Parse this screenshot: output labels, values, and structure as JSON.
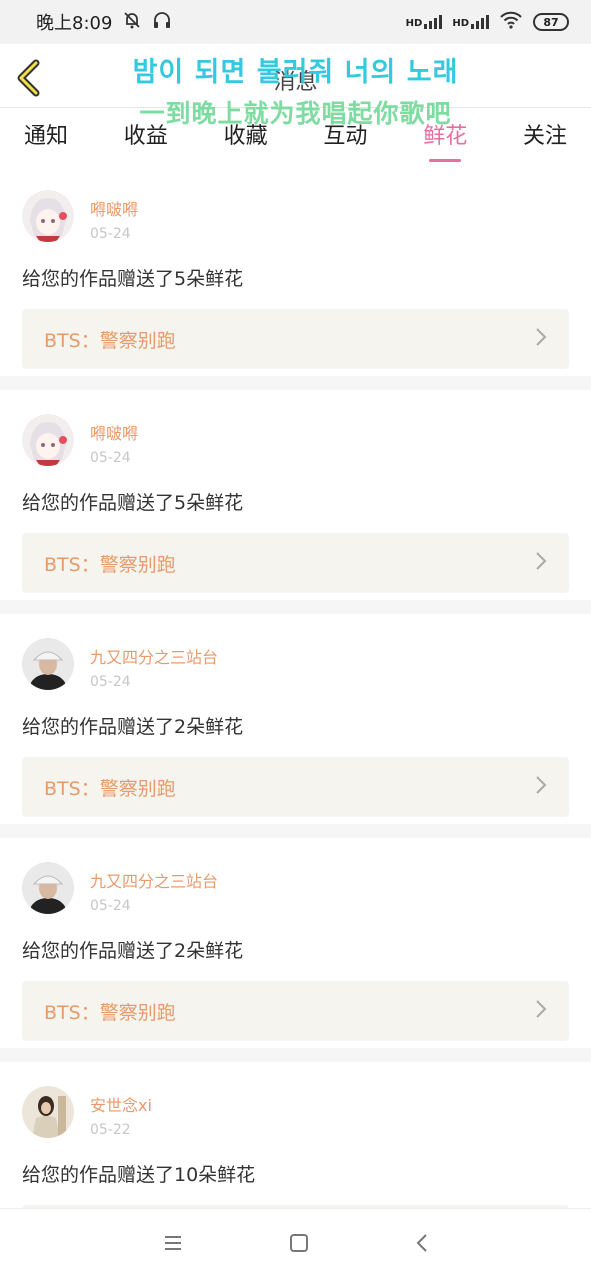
{
  "status_bar": {
    "time": "晚上8:09",
    "net_label_1": "HD",
    "net_label_2": "HD",
    "battery": "87"
  },
  "header": {
    "title": "消息",
    "lyric_korean": "밤이 되면 불러줘 너의 노래",
    "lyric_chinese": "一到晚上就为我唱起你歌吧"
  },
  "tabs": [
    {
      "label": "通知",
      "active": false
    },
    {
      "label": "收益",
      "active": false
    },
    {
      "label": "收藏",
      "active": false
    },
    {
      "label": "互动",
      "active": false
    },
    {
      "label": "鲜花",
      "active": true
    },
    {
      "label": "关注",
      "active": false
    }
  ],
  "items": [
    {
      "name": "嘚啵嘚",
      "date": "05-24",
      "message": "给您的作品赠送了5朵鲜花",
      "work": "BTS：警察别跑",
      "avatar": "anime-girl-avatar"
    },
    {
      "name": "嘚啵嘚",
      "date": "05-24",
      "message": "给您的作品赠送了5朵鲜花",
      "work": "BTS：警察别跑",
      "avatar": "anime-girl-avatar"
    },
    {
      "name": "九又四分之三站台",
      "date": "05-24",
      "message": "给您的作品赠送了2朵鲜花",
      "work": "BTS：警察别跑",
      "avatar": "cap-boy-avatar"
    },
    {
      "name": "九又四分之三站台",
      "date": "05-24",
      "message": "给您的作品赠送了2朵鲜花",
      "work": "BTS：警察别跑",
      "avatar": "cap-boy-avatar"
    },
    {
      "name": "安世念xi",
      "date": "05-22",
      "message": "给您的作品赠送了10朵鲜花",
      "work": "",
      "avatar": "photo-avatar"
    }
  ],
  "colors": {
    "accent": "#e76f9e",
    "username": "#e99a6a",
    "lyric_blue": "#33c9e0",
    "lyric_green": "#7ddca0",
    "card_bg": "#f5f4ee"
  },
  "icons": [
    "back-arrow-icon",
    "chevron-right-icon",
    "menu-icon",
    "home-icon",
    "back-icon",
    "mute-bell-icon",
    "headphones-icon",
    "wifi-icon"
  ]
}
